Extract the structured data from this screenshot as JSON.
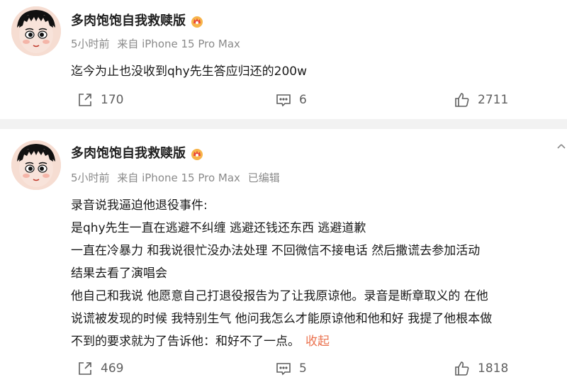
{
  "posts": [
    {
      "username": "多肉饱饱自我救赎版",
      "time": "5小时前",
      "source": "来自 iPhone 15 Pro Max",
      "edited": "",
      "content": [
        "迄今为止也没收到qhy先生答应归还的200w"
      ],
      "collapse": "",
      "repost_count": "170",
      "comment_count": "6",
      "like_count": "2711"
    },
    {
      "username": "多肉饱饱自我救赎版",
      "time": "5小时前",
      "source": "来自 iPhone 15 Pro Max",
      "edited": "已编辑",
      "content": [
        "录音说我逼迫他退役事件:",
        "是qhy先生一直在逃避不纠缠 逃避还钱还东西  逃避道歉",
        "一直在冷暴力  和我说很忙没办法处理  不回微信不接电话  然后撒谎去参加活动",
        "结果去看了演唱会",
        "他自己和我说  他愿意自己打退役报告为了让我原谅他。录音是断章取义的  在他",
        "说谎被发现的时候 我特别生气 他问我怎么才能原谅他和他和好 我提了他根本做",
        "不到的要求就为了告诉他：和好不了一点。"
      ],
      "collapse": "收起",
      "repost_count": "469",
      "comment_count": "5",
      "like_count": "1818"
    }
  ],
  "icons": {
    "avatar": "cartoon-avatar-icon",
    "vip": "vip-crown-badge-icon",
    "repost": "share-arrow-icon",
    "comment": "comment-bubble-icon",
    "like": "thumbs-up-icon",
    "more": "more-dots-icon"
  },
  "colors": {
    "collapse_link": "#eb7350",
    "meta_text": "#8a8a8a",
    "divider": "#f2f2f2"
  }
}
